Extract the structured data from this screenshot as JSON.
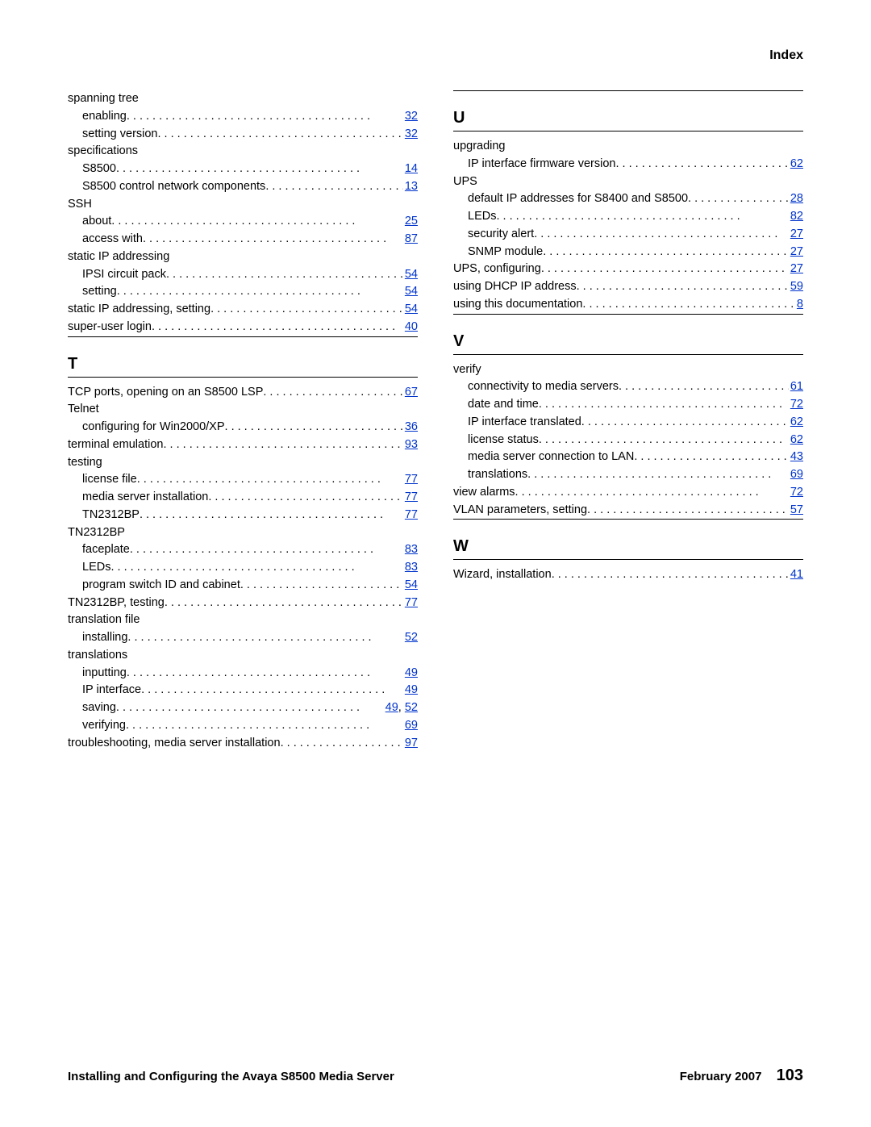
{
  "header": {
    "title": "Index"
  },
  "footer": {
    "doc_title": "Installing and Configuring the Avaya S8500 Media Server",
    "date": "February 2007",
    "page": "103"
  },
  "left_column": [
    {
      "type": "entry",
      "level": 0,
      "label": "spanning tree",
      "pages": []
    },
    {
      "type": "entry",
      "level": 1,
      "label": "enabling",
      "pages": [
        "32"
      ]
    },
    {
      "type": "entry",
      "level": 1,
      "label": "setting version",
      "pages": [
        "32"
      ]
    },
    {
      "type": "entry",
      "level": 0,
      "label": "specifications",
      "pages": []
    },
    {
      "type": "entry",
      "level": 1,
      "label": "S8500",
      "pages": [
        "14"
      ]
    },
    {
      "type": "entry",
      "level": 1,
      "label": "S8500 control network components",
      "pages": [
        "13"
      ]
    },
    {
      "type": "entry",
      "level": 0,
      "label": "SSH",
      "pages": []
    },
    {
      "type": "entry",
      "level": 1,
      "label": "about",
      "pages": [
        "25"
      ]
    },
    {
      "type": "entry",
      "level": 1,
      "label": "access with",
      "pages": [
        "87"
      ]
    },
    {
      "type": "entry",
      "level": 0,
      "label": "static IP addressing",
      "pages": []
    },
    {
      "type": "entry",
      "level": 1,
      "label": "IPSI circuit pack",
      "pages": [
        "54"
      ]
    },
    {
      "type": "entry",
      "level": 1,
      "label": "setting",
      "pages": [
        "54"
      ]
    },
    {
      "type": "entry",
      "level": 0,
      "label": "static IP addressing, setting",
      "pages": [
        "54"
      ]
    },
    {
      "type": "entry",
      "level": 0,
      "label": "super-user login",
      "pages": [
        "40"
      ]
    },
    {
      "type": "section",
      "letter": "T"
    },
    {
      "type": "entry",
      "level": 0,
      "label": "TCP ports, opening on an S8500 LSP",
      "pages": [
        "67"
      ]
    },
    {
      "type": "entry",
      "level": 0,
      "label": "Telnet",
      "pages": []
    },
    {
      "type": "entry",
      "level": 1,
      "label": "configuring for Win2000/XP",
      "pages": [
        "36"
      ]
    },
    {
      "type": "entry",
      "level": 0,
      "label": "terminal emulation",
      "pages": [
        "93"
      ]
    },
    {
      "type": "entry",
      "level": 0,
      "label": "testing",
      "pages": []
    },
    {
      "type": "entry",
      "level": 1,
      "label": "license file",
      "pages": [
        "77"
      ]
    },
    {
      "type": "entry",
      "level": 1,
      "label": "media server installation",
      "pages": [
        "77"
      ]
    },
    {
      "type": "entry",
      "level": 1,
      "label": "TN2312BP",
      "pages": [
        "77"
      ]
    },
    {
      "type": "entry",
      "level": 0,
      "label": "TN2312BP",
      "pages": []
    },
    {
      "type": "entry",
      "level": 1,
      "label": "faceplate",
      "pages": [
        "83"
      ]
    },
    {
      "type": "entry",
      "level": 1,
      "label": "LEDs",
      "pages": [
        "83"
      ]
    },
    {
      "type": "entry",
      "level": 1,
      "label": "program switch ID and cabinet",
      "pages": [
        "54"
      ]
    },
    {
      "type": "entry",
      "level": 0,
      "label": "TN2312BP, testing",
      "pages": [
        "77"
      ]
    },
    {
      "type": "entry",
      "level": 0,
      "label": "translation file",
      "pages": []
    },
    {
      "type": "entry",
      "level": 1,
      "label": "installing",
      "pages": [
        "52"
      ]
    },
    {
      "type": "entry",
      "level": 0,
      "label": "translations",
      "pages": []
    },
    {
      "type": "entry",
      "level": 1,
      "label": "inputting",
      "pages": [
        "49"
      ]
    },
    {
      "type": "entry",
      "level": 1,
      "label": "IP interface",
      "pages": [
        "49"
      ]
    },
    {
      "type": "entry",
      "level": 1,
      "label": "saving",
      "pages": [
        "49",
        "52"
      ]
    },
    {
      "type": "entry",
      "level": 1,
      "label": "verifying",
      "pages": [
        "69"
      ]
    },
    {
      "type": "entry",
      "level": 0,
      "label": "troubleshooting, media server installation",
      "pages": [
        "97"
      ]
    }
  ],
  "right_column": [
    {
      "type": "section",
      "letter": "U"
    },
    {
      "type": "entry",
      "level": 0,
      "label": "upgrading",
      "pages": []
    },
    {
      "type": "entry",
      "level": 1,
      "label": "IP interface firmware version",
      "pages": [
        "62"
      ]
    },
    {
      "type": "entry",
      "level": 0,
      "label": "UPS",
      "pages": []
    },
    {
      "type": "entry",
      "level": 1,
      "label": "default IP addresses for S8400 and S8500",
      "pages": [
        "28"
      ]
    },
    {
      "type": "entry",
      "level": 1,
      "label": "LEDs",
      "pages": [
        "82"
      ]
    },
    {
      "type": "entry",
      "level": 1,
      "label": "security alert",
      "pages": [
        "27"
      ]
    },
    {
      "type": "entry",
      "level": 1,
      "label": "SNMP module",
      "pages": [
        "27"
      ]
    },
    {
      "type": "entry",
      "level": 0,
      "label": "UPS, configuring",
      "pages": [
        "27"
      ]
    },
    {
      "type": "entry",
      "level": 0,
      "label": "using DHCP IP address",
      "pages": [
        "59"
      ]
    },
    {
      "type": "entry",
      "level": 0,
      "label": "using this documentation",
      "pages": [
        "8"
      ]
    },
    {
      "type": "section",
      "letter": "V"
    },
    {
      "type": "entry",
      "level": 0,
      "label": "verify",
      "pages": []
    },
    {
      "type": "entry",
      "level": 1,
      "label": "connectivity to media servers",
      "pages": [
        "61"
      ]
    },
    {
      "type": "entry",
      "level": 1,
      "label": "date and time",
      "pages": [
        "72"
      ]
    },
    {
      "type": "entry",
      "level": 1,
      "label": "IP interface translated",
      "pages": [
        "62"
      ]
    },
    {
      "type": "entry",
      "level": 1,
      "label": "license status",
      "pages": [
        "62"
      ]
    },
    {
      "type": "entry",
      "level": 1,
      "label": "media server connection to LAN",
      "pages": [
        "43"
      ]
    },
    {
      "type": "entry",
      "level": 1,
      "label": "translations",
      "pages": [
        "69"
      ]
    },
    {
      "type": "entry",
      "level": 0,
      "label": "view alarms",
      "pages": [
        "72"
      ]
    },
    {
      "type": "entry",
      "level": 0,
      "label": "VLAN parameters, setting",
      "pages": [
        "57"
      ]
    },
    {
      "type": "section",
      "letter": "W"
    },
    {
      "type": "entry",
      "level": 0,
      "label": "Wizard, installation",
      "pages": [
        "41"
      ]
    }
  ]
}
